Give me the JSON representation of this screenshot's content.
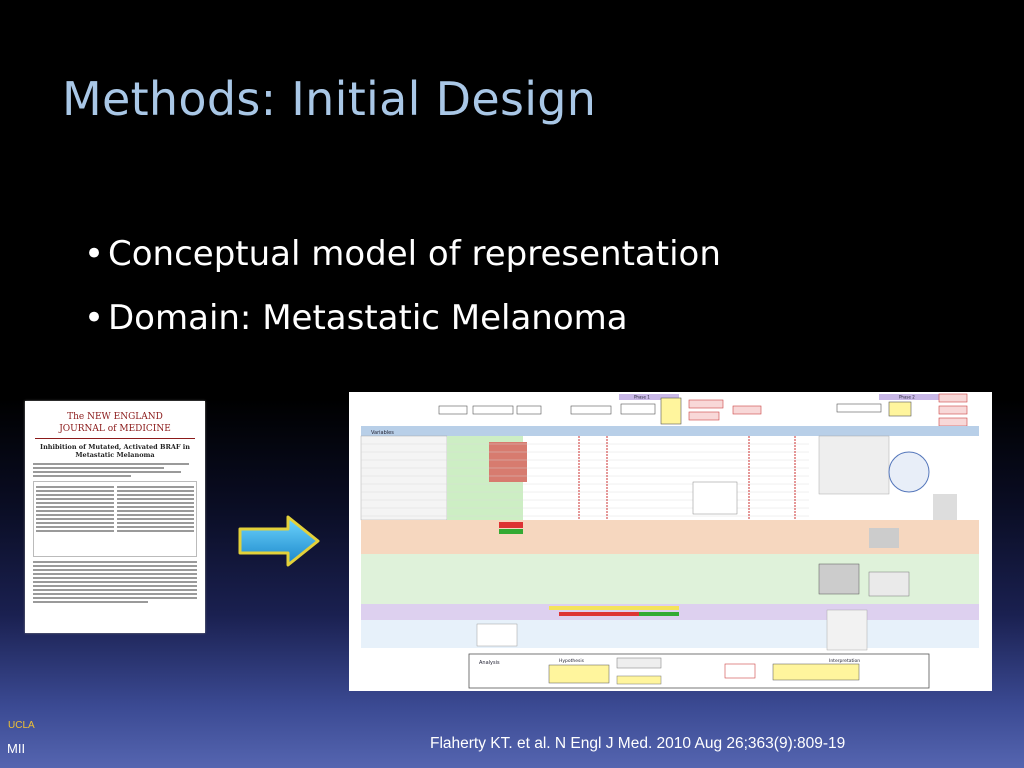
{
  "slide": {
    "title": "Methods: Initial Design",
    "bullets": [
      "Conceptual model of representation",
      "Domain: Metastatic Melanoma"
    ],
    "citation": "Flaherty KT. et al. N Engl J Med. 2010 Aug 26;363(9):809-19",
    "logo_line1": "UCLA",
    "logo_line2": "MII"
  },
  "journal_thumbnail": {
    "masthead_line1": "The NEW ENGLAND",
    "masthead_line2": "JOURNAL of MEDICINE",
    "article_title": "Inhibition of Mutated, Activated BRAF in Metastatic Melanoma"
  },
  "diagram_thumbnail": {
    "header_phase1": "Phase 1",
    "header_phase2": "Phase 2",
    "variables_label": "Variables",
    "analysis_label": "Analysis",
    "hypothesis_label": "Hypothesis",
    "interpretation_label": "Interpretation"
  },
  "colors": {
    "title": "#a9c7e6",
    "bullet_text": "#ffffff",
    "arrow_fill": "#1fa9e6",
    "arrow_border": "#e3d13a",
    "logo_ucla": "#f1c232"
  }
}
